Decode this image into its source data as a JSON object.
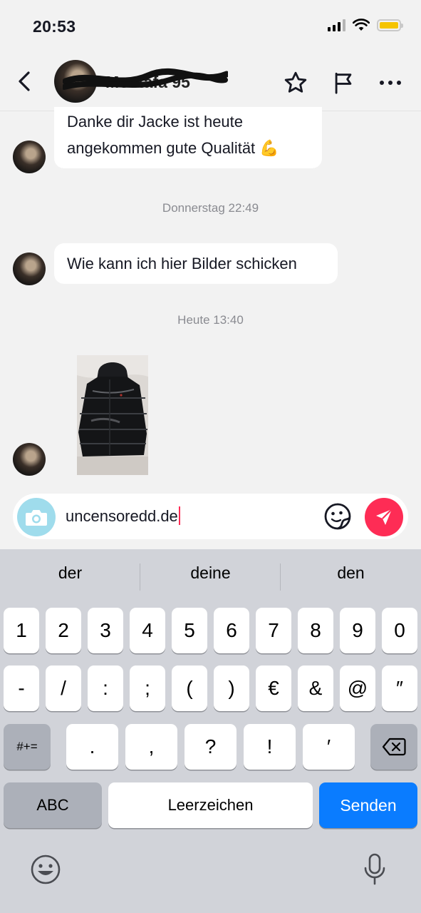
{
  "status_bar": {
    "time": "20:53",
    "signal_bars": 3,
    "battery_color": "#f5c400"
  },
  "header": {
    "contact_name": "Mostafa 95",
    "back_icon": "chevron-left-icon",
    "actions": [
      "star-icon",
      "flag-icon",
      "more-icon"
    ]
  },
  "messages": {
    "msg1_line1": "Danke dir Jacke ist heute",
    "msg1_line2": "angekommen gute Qualität 💪",
    "timestamp1": "Donnerstag 22:49",
    "msg2": "Wie kann ich hier Bilder schicken",
    "timestamp2": "Heute 13:40",
    "image": "photo of black puffer jacket"
  },
  "composer": {
    "value": "uncensoredd.de",
    "camera_icon": "camera-icon",
    "sticker_icon": "sticker-icon",
    "send_icon": "send-icon",
    "accent_color": "#fe2c55"
  },
  "keyboard": {
    "suggestions": [
      "der",
      "deine",
      "den"
    ],
    "row1": [
      "1",
      "2",
      "3",
      "4",
      "5",
      "6",
      "7",
      "8",
      "9",
      "0"
    ],
    "row2": [
      "-",
      "/",
      ":",
      ";",
      "(",
      ")",
      "€",
      "&",
      "@",
      "″"
    ],
    "row3_left": "#+=",
    "row3": [
      ".",
      ",",
      "?",
      "!",
      "′"
    ],
    "abc": "ABC",
    "space": "Leerzeichen",
    "send": "Senden"
  }
}
